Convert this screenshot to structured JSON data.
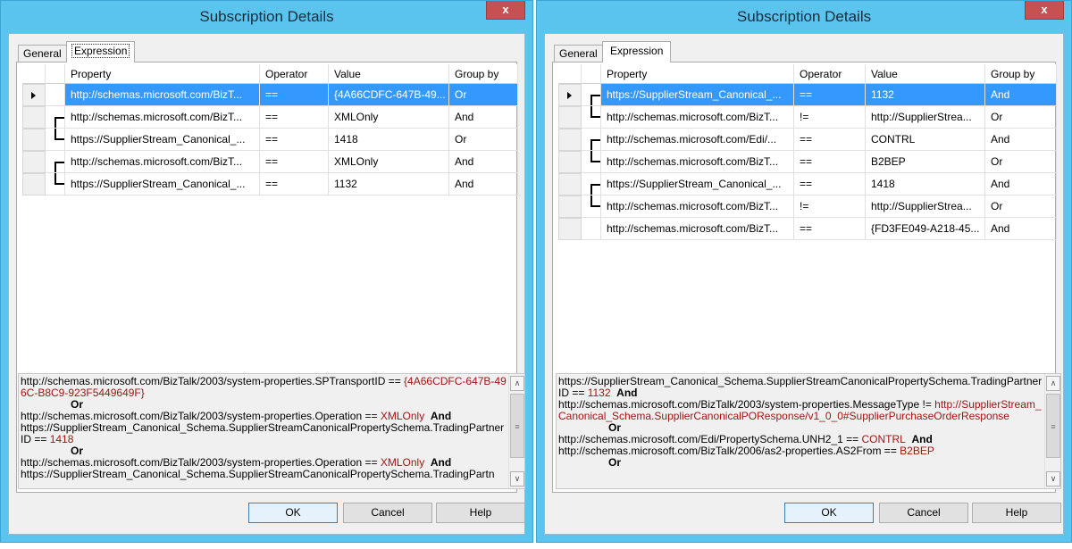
{
  "dialogs": [
    {
      "title": "Subscription Details",
      "close_label": "x",
      "tabs": [
        "General",
        "Expression"
      ],
      "columns": [
        "Property",
        "Operator",
        "Value",
        "Group by"
      ],
      "rows": [
        {
          "property": "http://schemas.microsoft.com/BizT...",
          "operator": "==",
          "value": "{4A66CDFC-647B-49...",
          "group": "Or"
        },
        {
          "property": "http://schemas.microsoft.com/BizT...",
          "operator": "==",
          "value": "XMLOnly",
          "group": "And"
        },
        {
          "property": "https://SupplierStream_Canonical_...",
          "operator": "==",
          "value": "1418",
          "group": "Or"
        },
        {
          "property": "http://schemas.microsoft.com/BizT...",
          "operator": "==",
          "value": "XMLOnly",
          "group": "And"
        },
        {
          "property": "https://SupplierStream_Canonical_...",
          "operator": "==",
          "value": "1132",
          "group": "And"
        }
      ],
      "expression": {
        "l1": "http://schemas.microsoft.com/BizTalk/2003/system-properties.SPTransportID == ",
        "l1v": "{4A66CDFC-647B-496C-B8C9-923F5449649F}",
        "or1": "Or",
        "l2": "http://schemas.microsoft.com/BizTalk/2003/system-properties.Operation == ",
        "l2v": "XMLOnly",
        "and1": "And",
        "l3": "https://SupplierStream_Canonical_Schema.SupplierStreamCanonicalPropertySchema.TradingPartnerID == ",
        "l3v": "1418",
        "or2": "Or",
        "l4": "http://schemas.microsoft.com/BizTalk/2003/system-properties.Operation == ",
        "l4v": "XMLOnly",
        "and2": "And",
        "l5": "https://SupplierStream_Canonical_Schema.SupplierStreamCanonicalPropertySchema.TradingPartn"
      },
      "buttons": {
        "ok": "OK",
        "cancel": "Cancel",
        "help": "Help"
      }
    },
    {
      "title": "Subscription Details",
      "close_label": "x",
      "tabs": [
        "General",
        "Expression"
      ],
      "columns": [
        "Property",
        "Operator",
        "Value",
        "Group by"
      ],
      "rows": [
        {
          "property": "https://SupplierStream_Canonical_...",
          "operator": "==",
          "value": "1132",
          "group": "And"
        },
        {
          "property": "http://schemas.microsoft.com/BizT...",
          "operator": "!=",
          "value": "http://SupplierStrea...",
          "group": "Or"
        },
        {
          "property": "http://schemas.microsoft.com/Edi/...",
          "operator": "==",
          "value": "CONTRL",
          "group": "And"
        },
        {
          "property": "http://schemas.microsoft.com/BizT...",
          "operator": "==",
          "value": "B2BEP",
          "group": "Or"
        },
        {
          "property": "https://SupplierStream_Canonical_...",
          "operator": "==",
          "value": "1418",
          "group": "And"
        },
        {
          "property": "http://schemas.microsoft.com/BizT...",
          "operator": "!=",
          "value": "http://SupplierStrea...",
          "group": "Or"
        },
        {
          "property": "http://schemas.microsoft.com/BizT...",
          "operator": "==",
          "value": "{FD3FE049-A218-45...",
          "group": "And"
        }
      ],
      "expression": {
        "l1": "https://SupplierStream_Canonical_Schema.SupplierStreamCanonicalPropertySchema.TradingPartnerID == ",
        "l1v": "1132",
        "and1": "And",
        "l2": "http://schemas.microsoft.com/BizTalk/2003/system-properties.MessageType != ",
        "l2v": "http://SupplierStream_Canonical_Schema.SupplierCanonicalPOResponse/v1_0_0#SupplierPurchaseOrderResponse",
        "or1": "Or",
        "l3": "http://schemas.microsoft.com/Edi/PropertySchema.UNH2_1 == ",
        "l3v": "CONTRL",
        "and2": "And",
        "l4": "http://schemas.microsoft.com/BizTalk/2006/as2-properties.AS2From == ",
        "l4v": "B2BEP",
        "or2": "Or"
      },
      "buttons": {
        "ok": "OK",
        "cancel": "Cancel",
        "help": "Help"
      }
    }
  ]
}
